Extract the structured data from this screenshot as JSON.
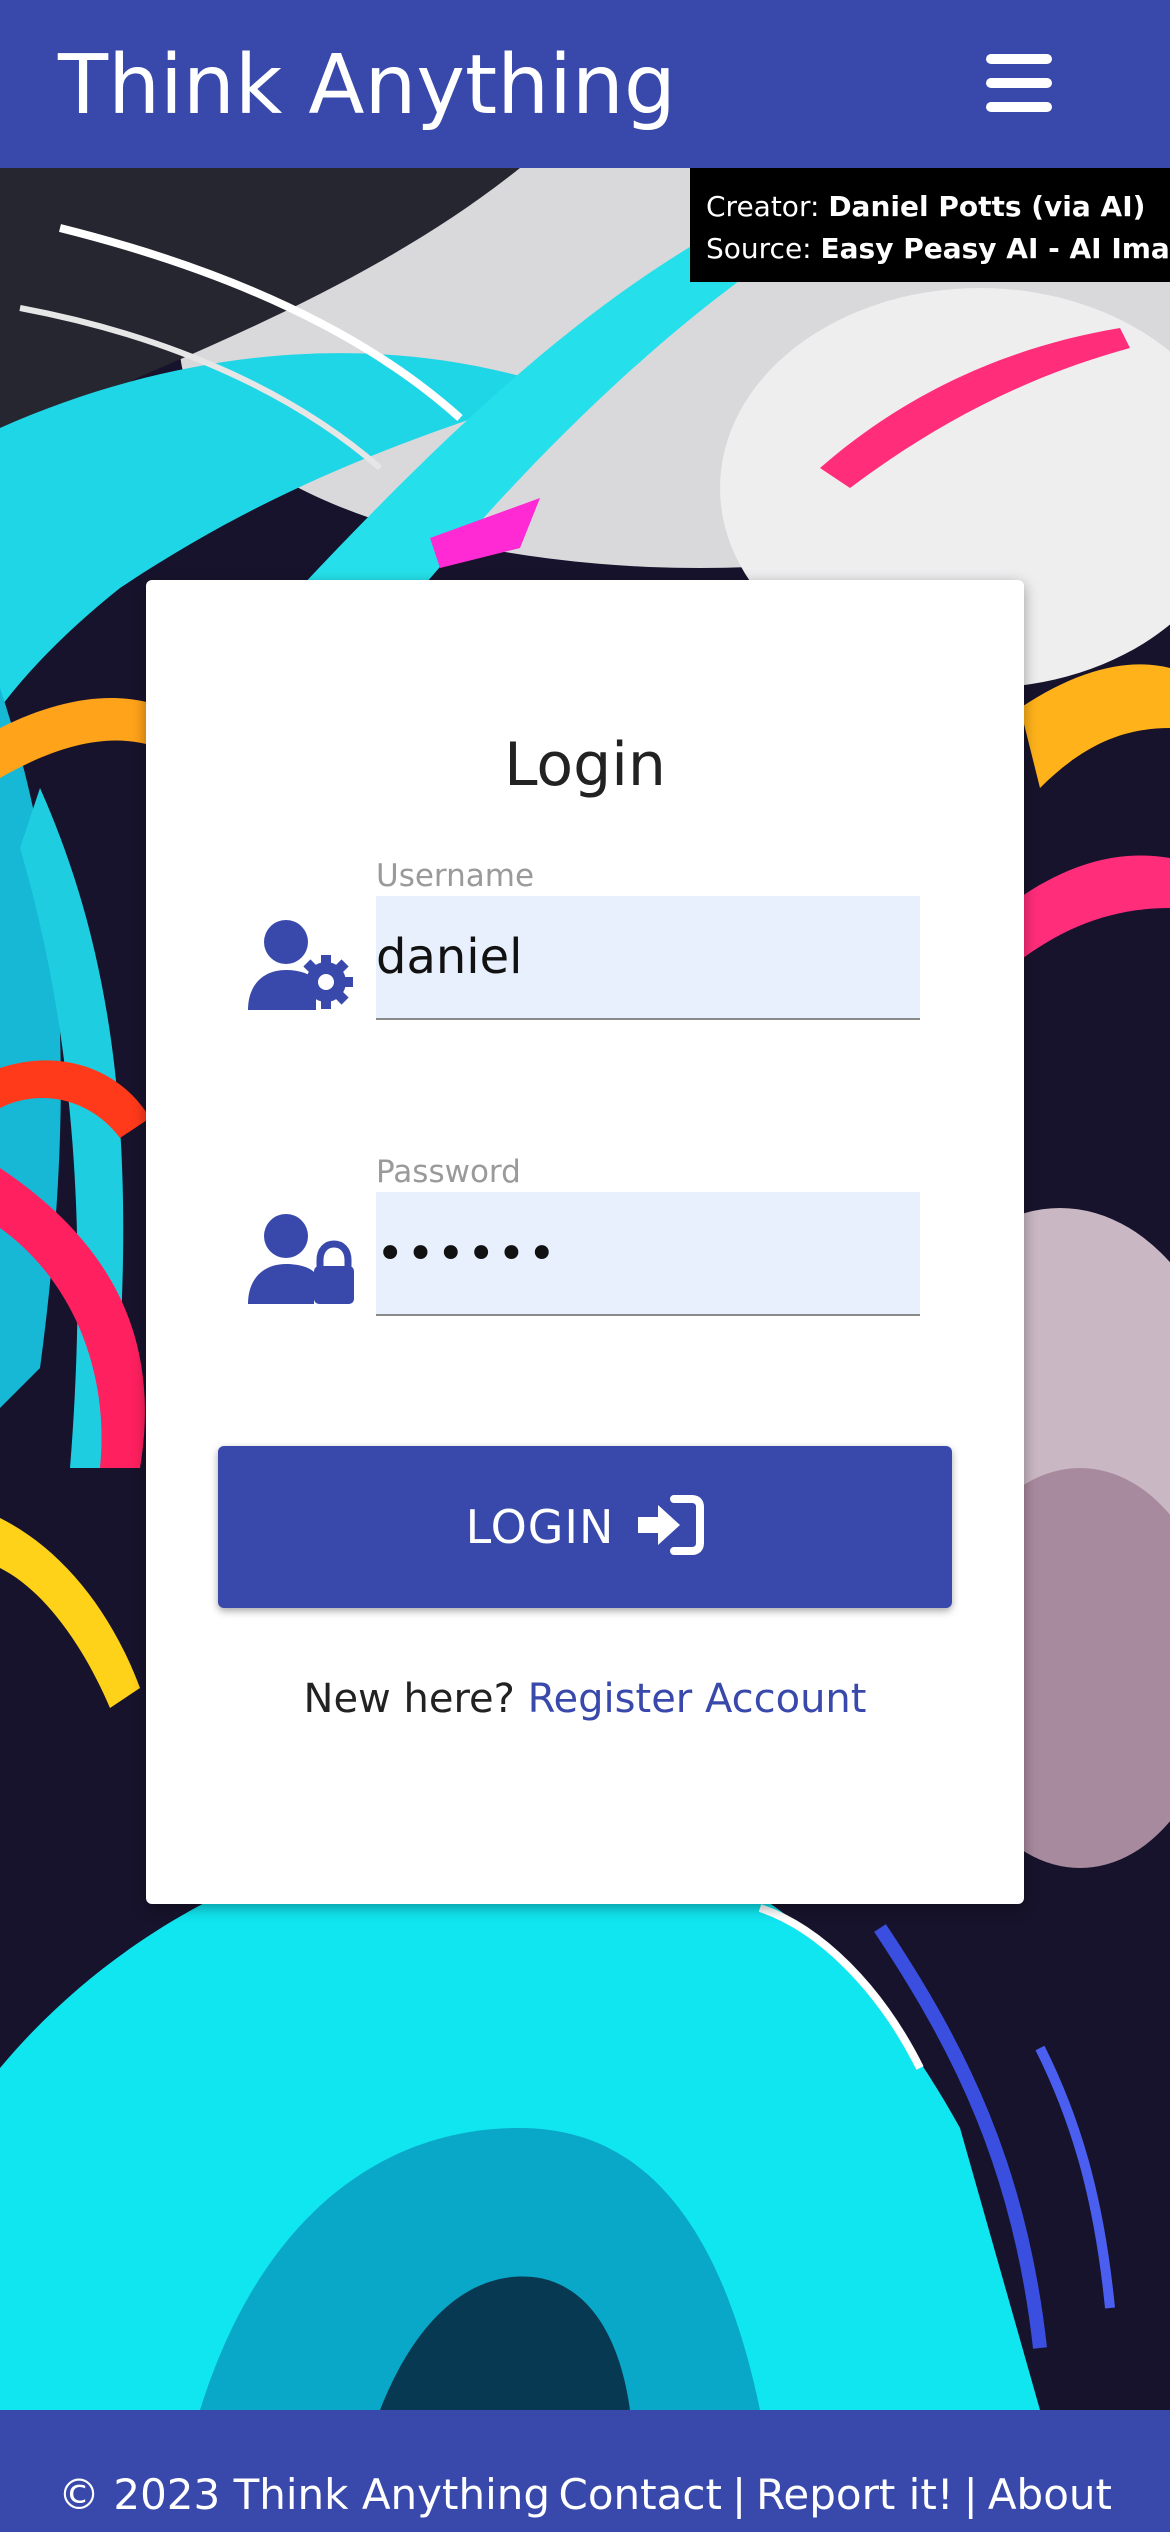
{
  "header": {
    "brand": "Think Anything",
    "menu_icon": "hamburger-menu-icon"
  },
  "credit": {
    "creator_label": "Creator:",
    "creator_name": "Daniel Potts (via AI)",
    "source_label": "Source:",
    "source_name": "Easy Peasy AI - AI Images"
  },
  "login": {
    "title": "Login",
    "username": {
      "label": "Username",
      "value": "daniel",
      "icon": "user-gear-icon"
    },
    "password": {
      "label": "Password",
      "value": "••••••",
      "icon": "user-lock-icon"
    },
    "button_label": "LOGIN",
    "button_icon": "sign-in-icon",
    "register_prompt": "New here?",
    "register_link": "Register Account"
  },
  "footer": {
    "copyright": "© 2023 Think Anything",
    "links": [
      "Contact",
      "Report it!",
      "About"
    ],
    "separator": "|"
  },
  "colors": {
    "primary": "#3949ab",
    "input_bg": "#e8f0fe",
    "card_bg": "#ffffff"
  }
}
